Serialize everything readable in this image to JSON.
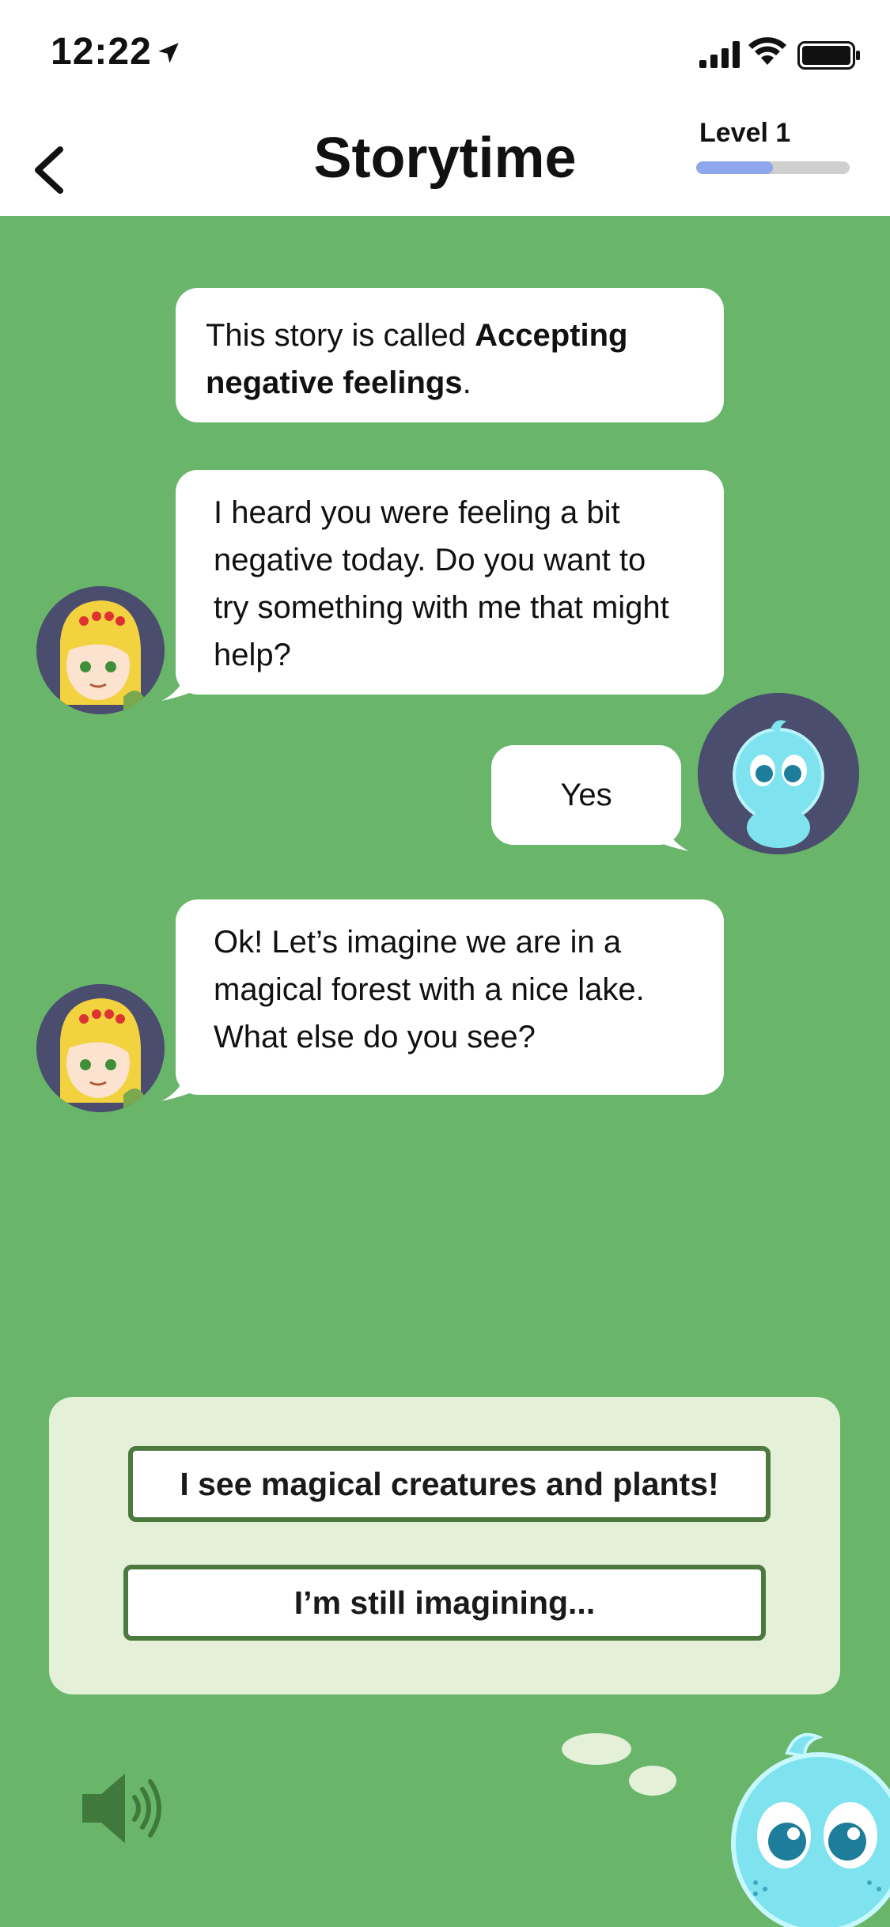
{
  "status_bar": {
    "time": "12:22"
  },
  "header": {
    "title": "Storytime",
    "level_label": "Level 1",
    "level_progress": 0.5
  },
  "messages": [
    {
      "sender": "narrator",
      "text_pre": "This story is called ",
      "text_bold": "Accepting negative feelings",
      "text_post": "."
    },
    {
      "sender": "guide",
      "text": "I heard you were feeling a bit negative today. Do you want to try something with me that might help?"
    },
    {
      "sender": "user",
      "text": "Yes"
    },
    {
      "sender": "guide",
      "text": "Ok! Let’s imagine we are in a magical forest with a nice lake. What else do you see?"
    }
  ],
  "responses": [
    {
      "label": "I see magical creatures and plants!"
    },
    {
      "label": "I’m still imagining..."
    }
  ],
  "colors": {
    "background": "#69b56a",
    "panel": "#e4f1d8",
    "button_border": "#4c7a3e",
    "progress_fill": "#8fa7ec",
    "avatar_bg": "#4a4d6e"
  },
  "icons": [
    "location-arrow-icon",
    "cellular-signal-icon",
    "wifi-icon",
    "battery-icon",
    "back-chevron-icon",
    "speaker-icon"
  ]
}
